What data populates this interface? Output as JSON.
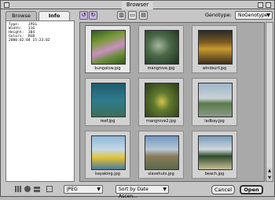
{
  "window": {
    "title": "Browser"
  },
  "tabs": [
    {
      "label": "Browse",
      "active": false
    },
    {
      "label": "Info",
      "active": true
    }
  ],
  "info": [
    "Type:    JPEG",
    "Width:   316",
    "Height:  304",
    "Colors:  RGB",
    "2000:02:04 15:23:02"
  ],
  "toolbar": {
    "genotype_label": "Genotype:",
    "genotype_value": "NoGenotype"
  },
  "thumbnails": [
    {
      "filename": "bungalow.jpg",
      "selected": true
    },
    {
      "filename": "mangrove.jpg",
      "selected": false
    },
    {
      "filename": "windsurf.jpg",
      "selected": false
    },
    {
      "filename": "reef.jpg",
      "selected": false
    },
    {
      "filename": "mangrove2.jpg",
      "selected": false
    },
    {
      "filename": "ladbay.jpg",
      "selected": false
    },
    {
      "filename": "kayaking.jpg",
      "selected": false
    },
    {
      "filename": "slavehuts.jpg",
      "selected": false
    },
    {
      "filename": "beach.jpg",
      "selected": false
    }
  ],
  "bottombar": {
    "format_value": "JPEG",
    "sort_value": "Sort by Date Ascen...",
    "cancel_label": "Cancel",
    "open_label": "Open"
  }
}
